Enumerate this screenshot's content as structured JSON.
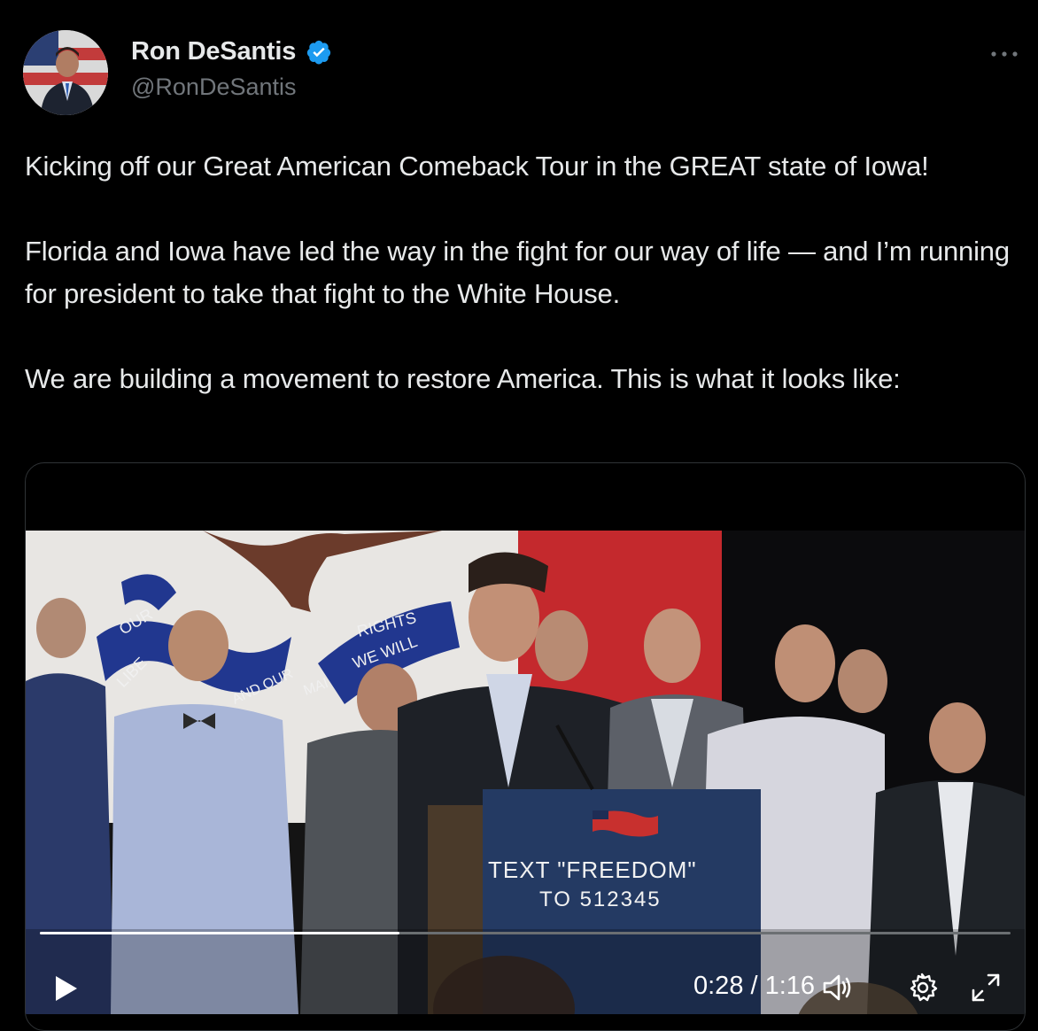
{
  "author": {
    "display_name": "Ron DeSantis",
    "handle": "@RonDeSantis",
    "verified": true,
    "verified_color": "#1d9bf0"
  },
  "more_icon": "more-horizontal-icon",
  "tweet": {
    "paragraphs": [
      "Kicking off our Great American Comeback Tour in the GREAT state of Iowa!",
      "Florida and Iowa have led the way in the fight for our way of life — and I’m running for president to take that fight to the White House.",
      "We are building a movement to restore America. This is what it looks like:"
    ]
  },
  "video": {
    "scene": {
      "banner_ribbon_left": "OUR LIBERTIES WE PRIZE AND OUR",
      "banner_ribbon_right": "RIGHTS WE WILL MAINTAIN",
      "podium_line1": "TEXT \"FREEDOM\"",
      "podium_line2": "TO 512345"
    },
    "time_display": "0:28 / 1:16",
    "progress": 0.37,
    "controls": {
      "play_icon": "play-icon",
      "volume_icon": "volume-icon",
      "settings_icon": "gear-icon",
      "fullscreen_icon": "fullscreen-icon"
    }
  }
}
